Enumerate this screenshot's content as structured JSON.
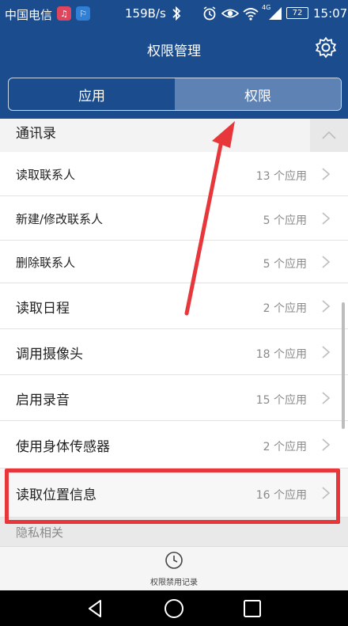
{
  "status_bar": {
    "carrier": "中国电信",
    "network_speed": "159B/s",
    "battery": "72",
    "time": "15:07",
    "network_badge": "4G",
    "icons": [
      "music-app-icon",
      "running-app-icon",
      "bluetooth-icon",
      "alarm-icon",
      "eye-icon",
      "wifi-icon",
      "signal-icon"
    ]
  },
  "header": {
    "title": "权限管理"
  },
  "tabs": [
    {
      "label": "应用",
      "active": false
    },
    {
      "label": "权限",
      "active": true
    }
  ],
  "sections": {
    "contacts": {
      "label": "通讯录"
    },
    "privacy": {
      "label": "隐私相关"
    }
  },
  "permissions": [
    {
      "label": "读取联系人",
      "count": "13 个应用"
    },
    {
      "label": "新建/修改联系人",
      "count": "5 个应用"
    },
    {
      "label": "删除联系人",
      "count": "5 个应用"
    },
    {
      "label": "读取日程",
      "count": "2 个应用"
    },
    {
      "label": "调用摄像头",
      "count": "18 个应用"
    },
    {
      "label": "启用录音",
      "count": "15 个应用"
    },
    {
      "label": "使用身体传感器",
      "count": "2 个应用"
    },
    {
      "label": "读取位置信息",
      "count": "16 个应用"
    }
  ],
  "bottom_action": {
    "label": "权限禁用记录"
  },
  "colors": {
    "header": "#1b4d8e",
    "active_tab": "#5d82b3",
    "annotation": "#e8373b"
  }
}
